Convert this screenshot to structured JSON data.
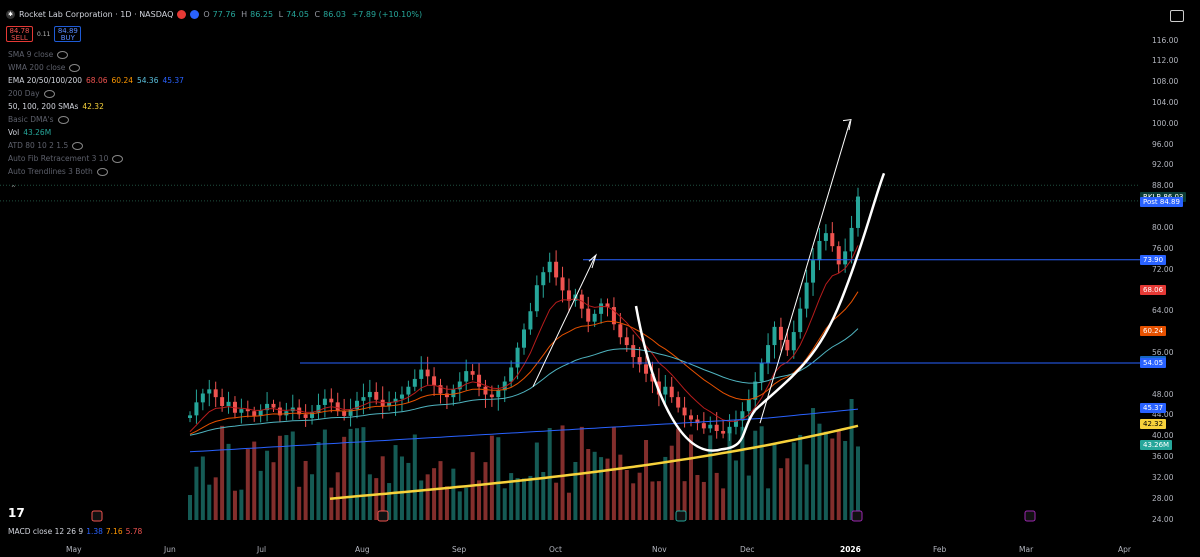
{
  "header": {
    "title": "Rocket Lab Corporation · 1D · NASDAQ",
    "open_label": "O",
    "open": "77.76",
    "high_label": "H",
    "high": "86.25",
    "low_label": "L",
    "low": "74.05",
    "close_label": "C",
    "close": "86.03",
    "change": "+7.89 (+10.10%)"
  },
  "trade": {
    "sell_price": "84.78",
    "sell_label": "SELL",
    "spread": "0.11",
    "buy_price": "84.89",
    "buy_label": "BUY"
  },
  "indicators": [
    {
      "name": "SMA 9 close",
      "values": [],
      "dim": true
    },
    {
      "name": "WMA 200 close",
      "values": [],
      "dim": true
    },
    {
      "name": "EMA 20/50/100/200",
      "values": [
        {
          "v": "68.06",
          "color": "#ef5350"
        },
        {
          "v": "60.24",
          "color": "#ff9800"
        },
        {
          "v": "54.36",
          "color": "#5bc0de"
        },
        {
          "v": "45.37",
          "color": "#2962ff"
        }
      ],
      "dim": false
    },
    {
      "name": "200 Day",
      "values": [],
      "dim": true
    },
    {
      "name": "50, 100, 200 SMAs",
      "values": [
        {
          "v": "42.32",
          "color": "#f7d23b"
        }
      ],
      "dim": false
    },
    {
      "name": "Basic DMA's",
      "values": [],
      "dim": true
    },
    {
      "name": "Vol",
      "values": [
        {
          "v": "43.26M",
          "color": "#26a69a"
        }
      ],
      "dim": false
    },
    {
      "name": "ATD 80 10 2 1.5",
      "values": [],
      "dim": true
    },
    {
      "name": "Auto Fib Retracement 3 10",
      "values": [],
      "dim": true
    },
    {
      "name": "Auto Trendlines 3 Both",
      "values": [],
      "dim": true
    }
  ],
  "macd": {
    "name": "MACD close 12 26 9",
    "v1": "1.38",
    "c1": "#2962ff",
    "v2": "7.16",
    "c2": "#ff9800",
    "v3": "5.78",
    "c3": "#ef5350"
  },
  "colors": {
    "up": "#26a69a",
    "down": "#ef5350",
    "line_blue": "#2962ff",
    "trend_white": "#ffffff",
    "sma200": "#f7d23b",
    "ema20": "#b71c1c",
    "ema50": "#e65100",
    "ema100": "#4fb3bf"
  },
  "chart_data": {
    "type": "candlestick",
    "symbol": "RKLB",
    "ylim": [
      24,
      116
    ],
    "y_ticks": [
      "116.00",
      "112.00",
      "108.00",
      "104.00",
      "100.00",
      "96.00",
      "92.00",
      "88.00",
      "80.00",
      "76.00",
      "72.00",
      "64.00",
      "56.00",
      "48.00",
      "44.00",
      "40.00",
      "36.00",
      "32.00",
      "28.00",
      "24.00"
    ],
    "x_ticks": [
      "May",
      "Jun",
      "Jul",
      "Aug",
      "Sep",
      "Oct",
      "Nov",
      "Dec",
      "2026",
      "Feb",
      "Mar",
      "Apr"
    ],
    "price_tags": [
      {
        "label": "RKLB",
        "value": "86.03",
        "y": 86.03,
        "color": "#26a69a"
      },
      {
        "label": "Post",
        "value": "84.89",
        "y": 84.89,
        "color": "#2962ff"
      },
      {
        "label": "",
        "value": "73.90",
        "y": 73.9,
        "color": "#2962ff"
      },
      {
        "label": "",
        "value": "68.06",
        "y": 68.06,
        "color": "#e53935"
      },
      {
        "label": "",
        "value": "60.24",
        "y": 60.24,
        "color": "#e65100"
      },
      {
        "label": "",
        "value": "54.36",
        "y": 54.36,
        "color": "#1565c0"
      },
      {
        "label": "",
        "value": "54.05",
        "y": 54.05,
        "color": "#2962ff"
      },
      {
        "label": "",
        "value": "45.37",
        "y": 45.37,
        "color": "#2962ff"
      },
      {
        "label": "",
        "value": "42.32",
        "y": 42.32,
        "color": "#f7d23b"
      },
      {
        "label": "",
        "value": "43.26M",
        "y": 38.4,
        "color": "#26a69a"
      }
    ],
    "horizontal_lines": [
      73.9,
      54.05
    ],
    "closes": [
      44.0,
      46.5,
      48.2,
      49.0,
      47.5,
      45.8,
      46.6,
      44.5,
      45.2,
      44.8,
      43.9,
      45.0,
      46.2,
      45.5,
      44.0,
      44.8,
      45.5,
      44.2,
      43.5,
      44.6,
      46.0,
      47.2,
      46.5,
      44.8,
      43.9,
      45.2,
      46.8,
      47.5,
      48.5,
      47.0,
      45.8,
      46.5,
      47.2,
      48.0,
      49.5,
      51.0,
      52.8,
      51.5,
      49.8,
      48.2,
      47.5,
      49.0,
      50.5,
      52.5,
      51.8,
      49.5,
      48.0,
      47.5,
      48.8,
      50.5,
      53.2,
      57.0,
      60.5,
      64.0,
      69.0,
      71.5,
      73.5,
      70.5,
      68.0,
      66.0,
      67.2,
      64.5,
      62.0,
      63.5,
      65.5,
      64.8,
      61.5,
      59.0,
      57.5,
      55.2,
      53.8,
      52.0,
      50.5,
      48.0,
      49.5,
      47.5,
      45.5,
      44.0,
      43.2,
      42.5,
      41.5,
      42.2,
      41.0,
      40.5,
      41.8,
      43.0,
      44.8,
      47.0,
      50.5,
      54.0,
      57.5,
      61.0,
      58.5,
      56.5,
      60.0,
      64.5,
      69.5,
      73.8,
      77.5,
      79.0,
      76.5,
      73.0,
      75.5,
      80.0,
      86.03
    ],
    "annotations": [
      "white arrow Sep-Oct rally",
      "cup-shaped curve Oct-Dec",
      "white arrow Dec rally to 100",
      "curved trendline up to 90"
    ]
  }
}
